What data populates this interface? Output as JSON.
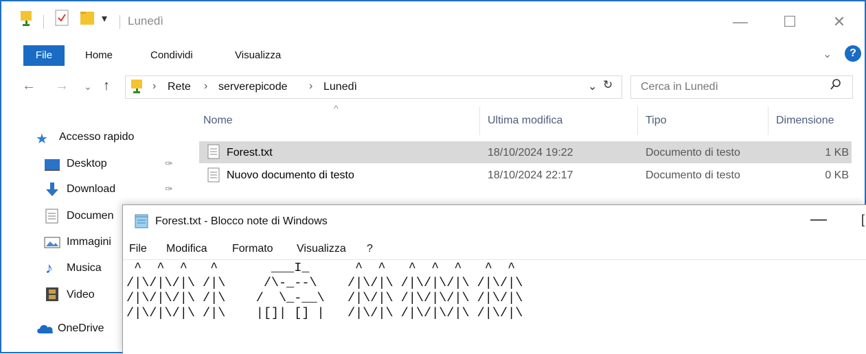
{
  "explorer": {
    "title": "Lunedì",
    "ribbon": {
      "file": "File",
      "home": "Home",
      "share": "Condividi",
      "view": "Visualizza"
    },
    "address": {
      "crumbs": [
        "Rete",
        "serverepicode",
        "Lunedì"
      ]
    },
    "search": {
      "placeholder": "Cerca in Lunedì"
    },
    "columns": {
      "name": "Nome",
      "modified": "Ultima modifica",
      "type": "Tipo",
      "size": "Dimensione"
    },
    "files": [
      {
        "name": "Forest.txt",
        "modified": "18/10/2024 19:22",
        "type": "Documento di testo",
        "size": "1 KB",
        "selected": true
      },
      {
        "name": "Nuovo documento di testo",
        "modified": "18/10/2024 22:17",
        "type": "Documento di testo",
        "size": "0 KB",
        "selected": false
      }
    ],
    "nav": {
      "quick_access": "Accesso rapido",
      "items": [
        "Desktop",
        "Download",
        "Documen",
        "Immagini",
        "Musica",
        "Video"
      ],
      "onedrive": "OneDrive"
    },
    "colors": {
      "accent": "#1a6bc4",
      "selected_row": "#d9d9d9",
      "header_text": "#4c5e7b"
    }
  },
  "notepad": {
    "title": "Forest.txt - Blocco note di Windows",
    "menu": [
      "File",
      "Modifica",
      "Formato",
      "Visualizza",
      "?"
    ],
    "content": " ^  ^  ^   ^       ___I_      ^  ^   ^  ^  ^   ^  ^\n/|\\/|\\/|\\ /|\\     /\\-_--\\    /|\\/|\\ /|\\/|\\/|\\ /|\\/|\\\n/|\\/|\\/|\\ /|\\    /  \\_-__\\   /|\\/|\\ /|\\/|\\/|\\ /|\\/|\\\n/|\\/|\\/|\\ /|\\    |[]| [] |   /|\\/|\\ /|\\/|\\/|\\ /|\\/|\\"
  }
}
